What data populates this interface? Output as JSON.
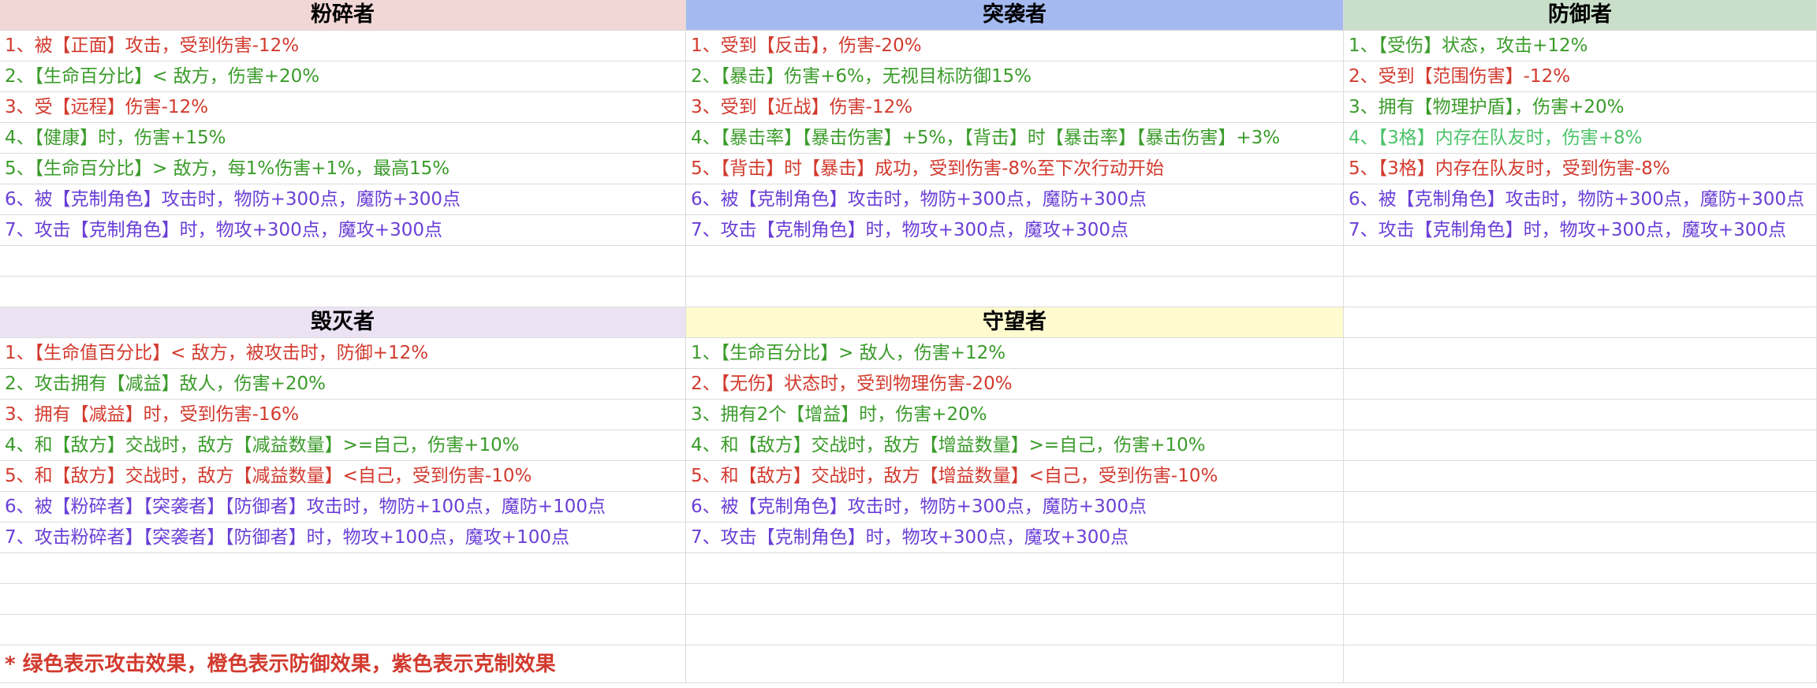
{
  "colors": {
    "header_smash": "#f2d7d7",
    "header_raid": "#a4b9ef",
    "header_guard": "#c9dfca",
    "header_destroy": "#ebe3f3",
    "header_watch": "#fffbcf",
    "attack": "#3a9b2a",
    "defense": "#d23a2e",
    "counter": "#6a3fd6"
  },
  "headers": {
    "smash": "粉碎者",
    "raid": "突袭者",
    "guard": "防御者",
    "destroy": "毁灭者",
    "watch": "守望者"
  },
  "smash": [
    "1、被【正面】攻击，受到伤害-12%",
    "2、【生命百分比】< 敌方，伤害+20%",
    "3、受【远程】伤害-12%",
    "4、【健康】时，伤害+15%",
    "5、【生命百分比】> 敌方，每1%伤害+1%，最高15%",
    "6、被【克制角色】攻击时，物防+300点，魔防+300点",
    "7、攻击【克制角色】时，物攻+300点，魔攻+300点"
  ],
  "raid": [
    "1、受到【反击】，伤害-20%",
    "2、【暴击】伤害+6%，无视目标防御15%",
    "3、受到【近战】伤害-12%",
    "4、【暴击率】【暴击伤害】+5%，【背击】时【暴击率】【暴击伤害】+3%",
    "5、【背击】时【暴击】成功，受到伤害-8%至下次行动开始",
    "6、被【克制角色】攻击时，物防+300点，魔防+300点",
    "7、攻击【克制角色】时，物攻+300点，魔攻+300点"
  ],
  "guard": [
    "1、【受伤】状态，攻击+12%",
    "2、受到【范围伤害】-12%",
    "3、拥有【物理护盾】，伤害+20%",
    "4、【3格】内存在队友时，伤害+8%",
    "5、【3格】内存在队友时，受到伤害-8%",
    "6、被【克制角色】攻击时，物防+300点，魔防+300点",
    "7、攻击【克制角色】时，物攻+300点，魔攻+300点"
  ],
  "destroy": [
    "1、【生命值百分比】< 敌方，被攻击时，防御+12%",
    "2、攻击拥有【减益】敌人，伤害+20%",
    "3、拥有【减益】时，受到伤害-16%",
    "4、和【敌方】交战时，敌方【减益数量】>=自己，伤害+10%",
    "5、和【敌方】交战时，敌方【减益数量】<自己，受到伤害-10%",
    "6、被【粉碎者】【突袭者】【防御者】攻击时，物防+100点，魔防+100点",
    "7、攻击粉碎者】【突袭者】【防御者】时，物攻+100点，魔攻+100点"
  ],
  "watch": [
    "1、【生命百分比】> 敌人，伤害+12%",
    "2、【无伤】状态时，受到物理伤害-20%",
    "3、拥有2个【增益】时，伤害+20%",
    "4、和【敌方】交战时，敌方【增益数量】>=自己，伤害+10%",
    "5、和【敌方】交战时，敌方【增益数量】<自己，受到伤害-10%",
    "6、被【克制角色】攻击时，物防+300点，魔防+300点",
    "7、攻击【克制角色】时，物攻+300点，魔攻+300点"
  ],
  "note": "* 绿色表示攻击效果，橙色表示防御效果，紫色表示克制效果"
}
